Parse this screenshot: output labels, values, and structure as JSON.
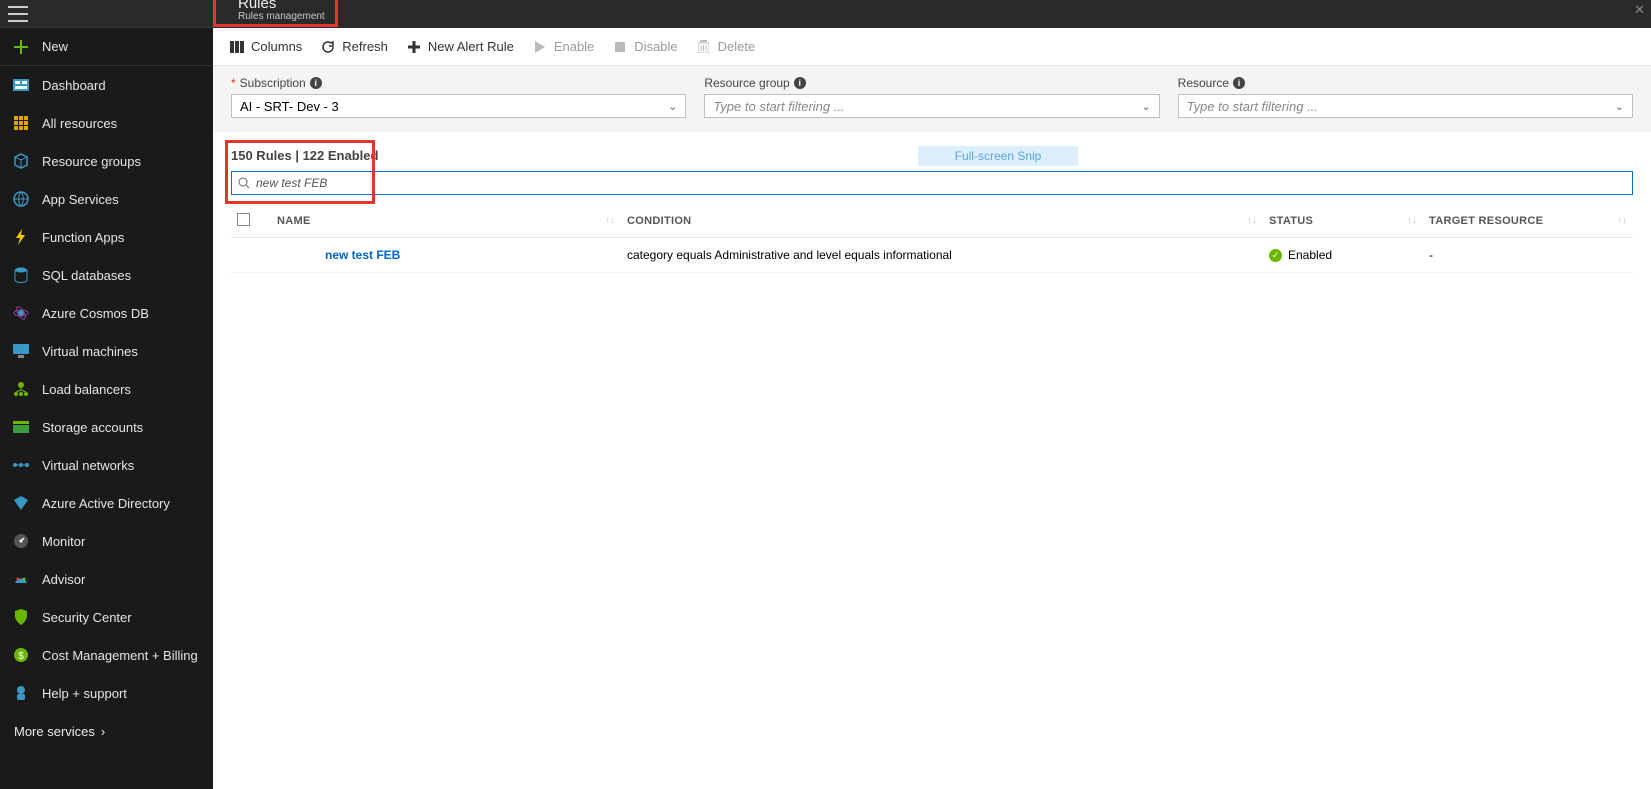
{
  "sidebar": {
    "new_label": "New",
    "items": [
      {
        "label": "Dashboard"
      },
      {
        "label": "All resources"
      },
      {
        "label": "Resource groups"
      },
      {
        "label": "App Services"
      },
      {
        "label": "Function Apps"
      },
      {
        "label": "SQL databases"
      },
      {
        "label": "Azure Cosmos DB"
      },
      {
        "label": "Virtual machines"
      },
      {
        "label": "Load balancers"
      },
      {
        "label": "Storage accounts"
      },
      {
        "label": "Virtual networks"
      },
      {
        "label": "Azure Active Directory"
      },
      {
        "label": "Monitor"
      },
      {
        "label": "Advisor"
      },
      {
        "label": "Security Center"
      },
      {
        "label": "Cost Management + Billing"
      },
      {
        "label": "Help + support"
      }
    ],
    "more_services": "More services"
  },
  "blade": {
    "title": "Rules",
    "subtitle": "Rules management"
  },
  "toolbar": {
    "columns": "Columns",
    "refresh": "Refresh",
    "new_rule": "New Alert Rule",
    "enable": "Enable",
    "disable": "Disable",
    "delete": "Delete"
  },
  "filters": {
    "subscription": {
      "label": "Subscription",
      "value": "AI - SRT- Dev - 3"
    },
    "resource_group": {
      "label": "Resource group",
      "placeholder": "Type to start filtering ..."
    },
    "resource": {
      "label": "Resource",
      "placeholder": "Type to start filtering ..."
    }
  },
  "rules_count": "150 Rules | 122 Enabled",
  "search_value": "new test FEB",
  "snip_badge": "Full-screen Snip",
  "table": {
    "headers": {
      "name": "NAME",
      "condition": "CONDITION",
      "status": "STATUS",
      "target": "TARGET RESOURCE"
    },
    "rows": [
      {
        "name": "new test FEB",
        "condition": "category equals Administrative and level equals informational",
        "status": "Enabled",
        "target": "-"
      }
    ]
  }
}
